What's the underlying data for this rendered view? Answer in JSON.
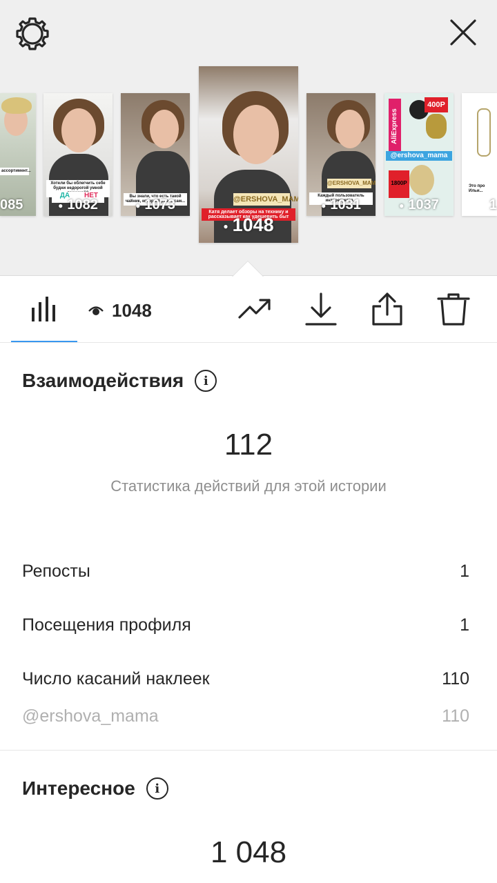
{
  "stories": [
    {
      "views": "085",
      "caption": "ассортимент..."
    },
    {
      "views": "1082",
      "caption": "Хотели бы облегчить себе будни недорогой умной техникой?",
      "poll_yes": "ДА",
      "poll_no": "НЕТ"
    },
    {
      "views": "1073",
      "caption": "Вы знали, что есть такой чайник, который умеет сам..."
    },
    {
      "views": "1048",
      "caption": "Катя делает обзоры на технику и рассказывает как удешевить быт",
      "sticker": "@ERSHOVA_MAMA"
    },
    {
      "views": "1031",
      "caption": "Каждый пользователь интересуется...",
      "sticker": "@ERSHOVA_MAMA"
    },
    {
      "views": "1037",
      "brand": "AliExpress",
      "price": "400Р",
      "price2": "1800Р",
      "sticker": "@ershova_mama"
    },
    {
      "views": "1",
      "caption": "Это про Ильи..."
    }
  ],
  "toolbar": {
    "views": "1048"
  },
  "interactions": {
    "title": "Взаимодействия",
    "total": "112",
    "subtitle": "Статистика действий для этой истории",
    "rows": [
      {
        "label": "Репосты",
        "value": "1"
      },
      {
        "label": "Посещения профиля",
        "value": "1"
      },
      {
        "label": "Число касаний наклеек",
        "value": "110"
      },
      {
        "label": "@ershova_mama",
        "value": "110"
      }
    ]
  },
  "discovery": {
    "title": "Интересное",
    "total": "1 048"
  },
  "colors": {
    "accent": "#3897f0",
    "text": "#262626",
    "muted": "#8e8e8e",
    "background_top": "#efefef"
  }
}
